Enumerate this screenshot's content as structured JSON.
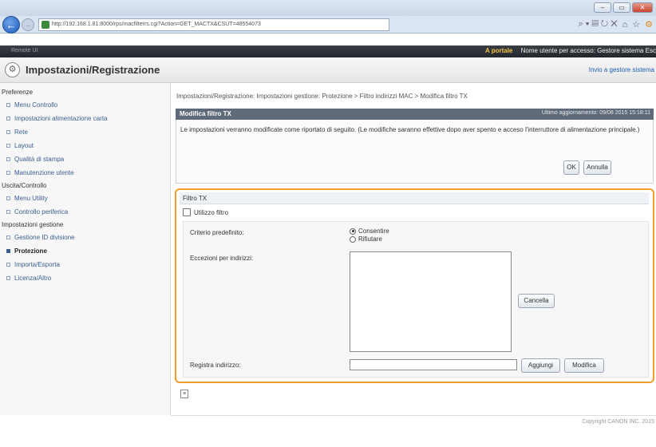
{
  "browser": {
    "url": "http://192.168.1.81:8000/rps/macfilterrs.cgi?Action=GET_MACTX&CSUT=48554073",
    "nav_tools": "⌕ ▾ ▤ ↻ ✕",
    "window_buttons": [
      "–",
      "▭",
      "✕"
    ]
  },
  "appbar": {
    "left_text": "Remote UI",
    "portal_label": "A portale",
    "user_text": "Nome utente per accesso: Gestore sistema Esc"
  },
  "header": {
    "title": "Impostazioni/Registrazione",
    "mail_link": "Invio a gestore sistema"
  },
  "sidebar": {
    "groups": [
      {
        "title": "Preferenze",
        "items": [
          "Menu Controllo",
          "Impostazioni alimentazione carta",
          "Rete",
          "Layout",
          "Qualità di stampa",
          "Manutenzione utente"
        ]
      },
      {
        "title": "Uscita/Controllo",
        "items": [
          "Menu Utility",
          "Controllo periferica"
        ]
      },
      {
        "title": "Impostazioni gestione",
        "items": [
          "Gestione ID divisione",
          "Protezione",
          "Importa/Esporta",
          "Licenza/Altro"
        ]
      }
    ],
    "active_item": "Protezione"
  },
  "breadcrumb": "Impostazioni/Registrazione: Impostazioni gestione: Protezione > Filtro indirizzi MAC > Modifica filtro TX",
  "panel": {
    "title": "Modifica filtro TX",
    "last_update": "Ultimo aggiornamento: 09/08 2015 15:18:11",
    "message": "Le impostazioni verranno modificate come riportato di seguito. (Le modifiche saranno effettive dopo aver spento e acceso l'interruttore di alimentazione principale.)",
    "ok_label": "OK",
    "cancel_label": "Annulla"
  },
  "filter": {
    "title": "Filtro TX",
    "use_filter_label": "Utilizzo filtro",
    "use_filter_checked": false,
    "default_policy_label": "Criterio predefinito:",
    "allow_label": "Consentire",
    "reject_label": "Rifiutare",
    "selected_policy": "Consentire",
    "exceptions_label": "Eccezioni per indirizzi:",
    "exceptions": [],
    "delete_label": "Cancella",
    "register_label": "Registra indirizzo:",
    "register_value": "",
    "add_label": "Aggiungi",
    "modify_label": "Modifica"
  },
  "footer": {
    "copyright": "Copyright CANON INC. 2015"
  },
  "colors": {
    "accent_orange": "#f39c26",
    "panel_header": "#5f6b7a",
    "link_blue": "#1d5fb0",
    "appbar": "#23272c"
  }
}
